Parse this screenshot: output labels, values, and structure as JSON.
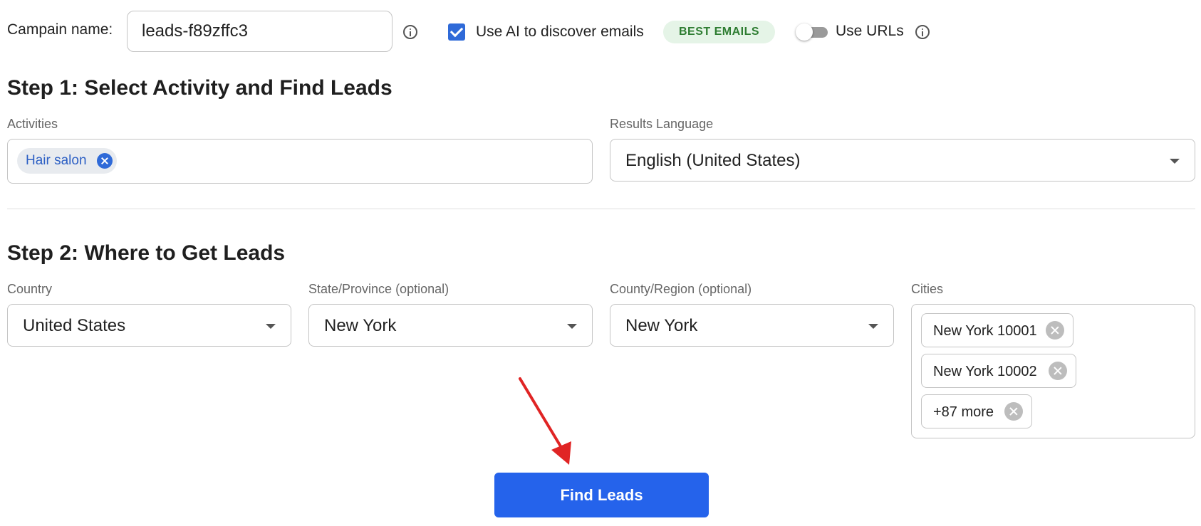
{
  "header": {
    "campaign_label": "Campain name:",
    "campaign_value": "leads-f89zffc3",
    "ai_label": "Use AI to discover emails",
    "ai_checked": true,
    "best_emails_badge": "BEST EMAILS",
    "use_urls_label": "Use URLs",
    "use_urls_enabled": false
  },
  "step1": {
    "heading": "Step 1: Select Activity and Find Leads",
    "activities_label": "Activities",
    "activities": [
      "Hair salon"
    ],
    "results_language_label": "Results Language",
    "results_language_value": "English (United States)"
  },
  "step2": {
    "heading": "Step 2: Where to Get Leads",
    "country_label": "Country",
    "country_value": "United States",
    "state_label": "State/Province (optional)",
    "state_value": "New York",
    "county_label": "County/Region (optional)",
    "county_value": "New York",
    "cities_label": "Cities",
    "cities": [
      "New York 10001",
      "New York 10002",
      "+87 more"
    ]
  },
  "actions": {
    "find_leads_label": "Find Leads"
  },
  "colors": {
    "accent": "#2563eb",
    "checkbox": "#2f6ad8",
    "badge_bg": "#e5f4e7",
    "badge_text": "#2e7d32",
    "arrow": "#e02424"
  },
  "icons": [
    "info-icon",
    "check-icon",
    "toggle-switch",
    "dropdown-caret-icon",
    "remove-chip-icon",
    "annotation-arrow"
  ]
}
